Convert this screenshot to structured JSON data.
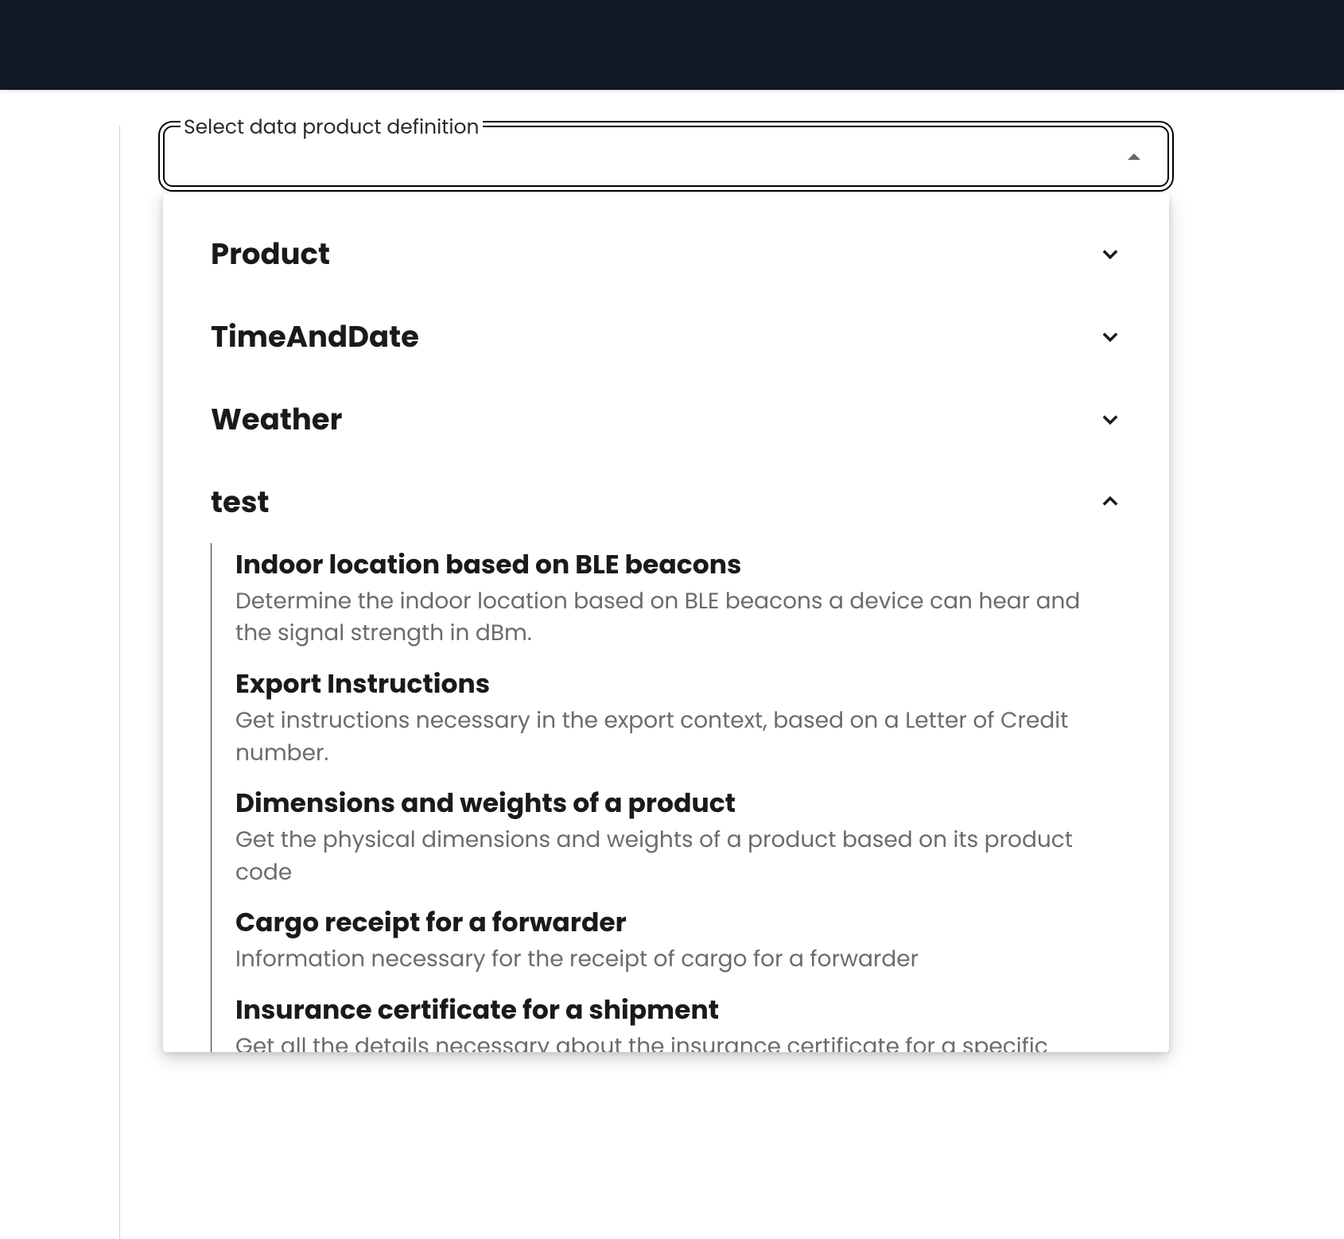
{
  "select": {
    "label": "Select data product definition",
    "value": ""
  },
  "groups": [
    {
      "name": "Product",
      "expanded": false
    },
    {
      "name": "TimeAndDate",
      "expanded": false
    },
    {
      "name": "Weather",
      "expanded": false
    },
    {
      "name": "test",
      "expanded": true
    }
  ],
  "testItems": [
    {
      "title": "Indoor location based on BLE beacons",
      "desc": "Determine the indoor location based on BLE beacons a device can hear and the signal strength in dBm."
    },
    {
      "title": "Export Instructions",
      "desc": "Get instructions necessary in the export context, based on a Letter of Credit number."
    },
    {
      "title": "Dimensions and weights of a product",
      "desc": "Get the physical dimensions and weights of a product based on its product code"
    },
    {
      "title": "Cargo receipt for a forwarder",
      "desc": "Information necessary for the receipt of cargo for a forwarder"
    },
    {
      "title": "Insurance certificate for a shipment",
      "desc": "Get all the details necessary about the insurance certificate for a specific"
    }
  ]
}
